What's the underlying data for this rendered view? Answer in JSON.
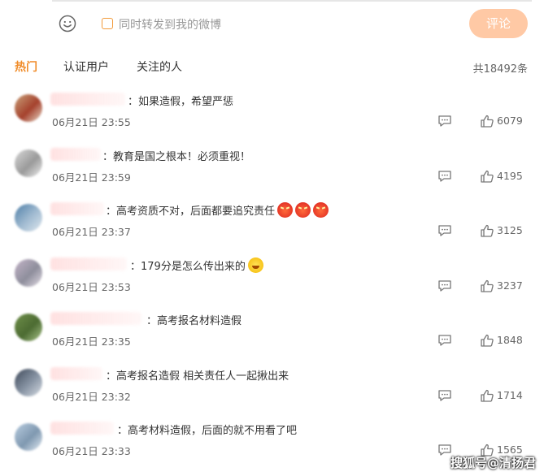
{
  "composer": {
    "repost_label": "同时转发到我的微博",
    "submit_label": "评论"
  },
  "tabs": [
    {
      "label": "热门",
      "active": true
    },
    {
      "label": "认证用户",
      "active": false
    },
    {
      "label": "关注的人",
      "active": false
    }
  ],
  "total_count": "共18492条",
  "comments": [
    {
      "text": "：如果造假，希望严惩",
      "time": "06月21日 23:55",
      "likes": "6079",
      "emoji": []
    },
    {
      "text": "：教育是国之根本！必须重视！",
      "time": "06月21日 23:59",
      "likes": "4195",
      "emoji": []
    },
    {
      "text": "：高考资质不对，后面都要追究责任",
      "time": "06月21日 23:37",
      "likes": "3125",
      "emoji": [
        "angry-face-icon",
        "angry-face-icon",
        "angry-face-icon"
      ]
    },
    {
      "text": "：179分是怎么传出来的",
      "time": "06月21日 23:53",
      "likes": "3237",
      "emoji": [
        "laughing-tears-icon"
      ]
    },
    {
      "text": "：高考报名材料造假",
      "time": "06月21日 23:35",
      "likes": "1848",
      "emoji": []
    },
    {
      "text": "：高考报名造假 相关责任人一起揪出来",
      "time": "06月21日 23:32",
      "likes": "1714",
      "emoji": []
    },
    {
      "text": "：高考材料造假，后面的就不用看了吧",
      "time": "06月21日 23:33",
      "likes": "1565",
      "emoji": []
    }
  ],
  "watermark": "搜狐号@清扬君",
  "colors": {
    "accent": "#f08c2a",
    "button_bg": "#ffc9a5"
  }
}
